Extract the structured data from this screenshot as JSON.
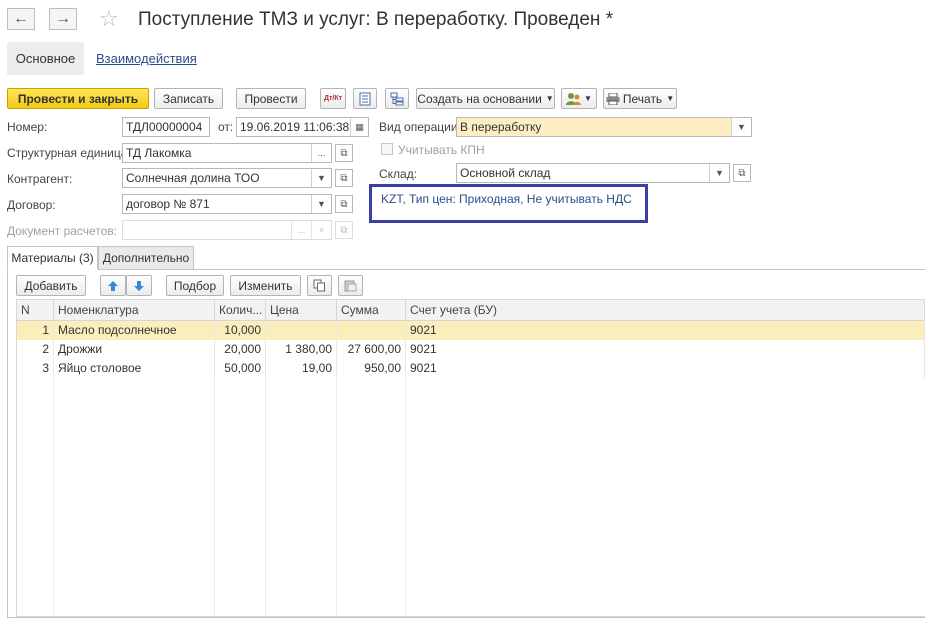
{
  "window": {
    "title": "Поступление ТМЗ и услуг: В переработку. Проведен *",
    "back_icon": "←",
    "forward_icon": "→",
    "star_icon": "☆"
  },
  "nav_tabs": {
    "main": "Основное",
    "interactions": "Взаимодействия"
  },
  "toolbar": {
    "post_and_close": "Провести и закрыть",
    "save": "Записать",
    "post": "Провести",
    "create_based_on": "Создать на основании",
    "print": "Печать",
    "dt_kt_icon": "Дт/Кт"
  },
  "form": {
    "number_label": "Номер:",
    "number_value": "ТДЛ00000004",
    "date_label": "от:",
    "date_value": "19.06.2019 11:06:38",
    "operation_label": "Вид операции:",
    "operation_value": "В переработку",
    "unit_label": "Структурная единица:",
    "unit_value": "ТД Лакомка",
    "kpn_label": "Учитывать КПН",
    "contractor_label": "Контрагент:",
    "contractor_value": "Солнечная долина ТОО",
    "warehouse_label": "Склад:",
    "warehouse_value": "Основной склад",
    "contract_label": "Договор:",
    "contract_value": "договор № 871",
    "payment_doc_label": "Документ расчетов:",
    "payment_doc_value": "",
    "price_info": "KZT, Тип цен: Приходная, Не учитывать НДС"
  },
  "tabs": {
    "materials": "Материалы (3)",
    "additional": "Дополнительно"
  },
  "table_toolbar": {
    "add": "Добавить",
    "pick": "Подбор",
    "edit": "Изменить"
  },
  "table": {
    "columns": [
      "N",
      "Номенклатура",
      "Колич...",
      "Цена",
      "Сумма",
      "Счет учета (БУ)"
    ],
    "rows": [
      {
        "n": "1",
        "name": "Масло подсолнечное",
        "qty": "10,000",
        "price": "",
        "sum": "",
        "account": "9021"
      },
      {
        "n": "2",
        "name": "Дрожжи",
        "qty": "20,000",
        "price": "1 380,00",
        "sum": "27 600,00",
        "account": "9021"
      },
      {
        "n": "3",
        "name": "Яйцо столовое",
        "qty": "50,000",
        "price": "19,00",
        "sum": "950,00",
        "account": "9021"
      }
    ]
  }
}
